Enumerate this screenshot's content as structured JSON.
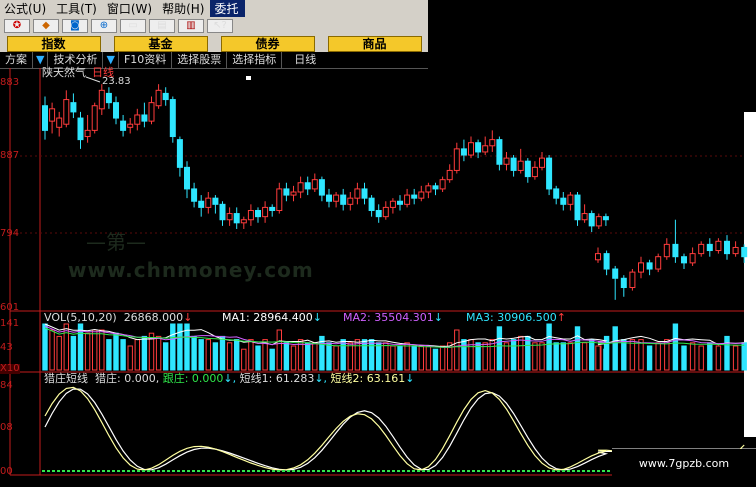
{
  "menu": [
    "公式(U)",
    "工具(T)",
    "窗口(W)",
    "帮助(H)",
    "委托"
  ],
  "categories": [
    "指数",
    "基金",
    "债券",
    "商品"
  ],
  "tabs": [
    "方案",
    "技术分析",
    "F10资料",
    "选择股票",
    "选择指标",
    "日线"
  ],
  "stock": {
    "name": "陕天然气",
    "period": "日线",
    "high_mark": "23.83"
  },
  "price_axis": [
    "883",
    "887",
    "794",
    "601"
  ],
  "vol": {
    "title": "VOL(5,10,20)",
    "value": "26868.000",
    "ma1_label": "MA1:",
    "ma1": "28964.400",
    "ma2_label": "MA2:",
    "ma2": "35504.301",
    "ma3_label": "MA3:",
    "ma3": "30906.500",
    "axis": [
      "141",
      "43",
      "X10"
    ]
  },
  "ind": {
    "title": "猎庄短线",
    "l1": "猎庄: 0.000,",
    "l2": "跟庄: 0.000",
    "l3": "短线1: 61.283",
    "l4": "短线2: 63.161",
    "axis": [
      "84",
      "08",
      "00"
    ]
  },
  "watermark": "www.chnmoney.com",
  "site": "www.7gpzb.com",
  "colors": {
    "up": "#ff3c3c",
    "down": "#2fe6ff",
    "line": "#ffffa0",
    "ma_white": "#ffffff",
    "ma_purple": "#d060ff"
  },
  "chart_data": {
    "type": "candlestick",
    "series": [
      {
        "values": [
          [
            103,
            95,
            92,
            106
          ],
          [
            98,
            102,
            94,
            104
          ],
          [
            96,
            99,
            93,
            101
          ],
          [
            97,
            105,
            96,
            108
          ],
          [
            104,
            101,
            99,
            107
          ],
          [
            99,
            92,
            89,
            101
          ],
          [
            93,
            95,
            91,
            100
          ],
          [
            95,
            103,
            94,
            104
          ],
          [
            102,
            108,
            100,
            110
          ],
          [
            107,
            104,
            102,
            109
          ],
          [
            104,
            99,
            97,
            106
          ],
          [
            98,
            95,
            93,
            100
          ],
          [
            96,
            97,
            94,
            99
          ],
          [
            97,
            100,
            95,
            102
          ],
          [
            100,
            98,
            96,
            104
          ],
          [
            98,
            104,
            97,
            106
          ],
          [
            103,
            108,
            102,
            110
          ],
          [
            107,
            105,
            103,
            109
          ],
          [
            105,
            93,
            91,
            106
          ],
          [
            92,
            83,
            80,
            93
          ],
          [
            83,
            76,
            73,
            85
          ],
          [
            76,
            72,
            70,
            78
          ],
          [
            72,
            70,
            67,
            74
          ],
          [
            70,
            73,
            68,
            75
          ],
          [
            73,
            71,
            68,
            74
          ],
          [
            71,
            66,
            64,
            72
          ],
          [
            66,
            68,
            64,
            70
          ],
          [
            68,
            65,
            63,
            70
          ],
          [
            65,
            66,
            63,
            67
          ],
          [
            66,
            69,
            64,
            71
          ],
          [
            69,
            67,
            65,
            70
          ],
          [
            67,
            70,
            65,
            72
          ],
          [
            70,
            69,
            67,
            71
          ],
          [
            69,
            76,
            68,
            78
          ],
          [
            76,
            74,
            72,
            78
          ],
          [
            74,
            75,
            72,
            77
          ],
          [
            75,
            78,
            73,
            80
          ],
          [
            78,
            76,
            74,
            80
          ],
          [
            76,
            79,
            75,
            81
          ],
          [
            79,
            74,
            72,
            80
          ],
          [
            74,
            72,
            70,
            76
          ],
          [
            72,
            74,
            70,
            75
          ],
          [
            74,
            71,
            69,
            76
          ],
          [
            71,
            73,
            69,
            75
          ],
          [
            73,
            76,
            71,
            78
          ],
          [
            76,
            73,
            71,
            78
          ],
          [
            73,
            69,
            67,
            74
          ],
          [
            69,
            67,
            65,
            71
          ],
          [
            67,
            70,
            66,
            72
          ],
          [
            70,
            72,
            68,
            73
          ],
          [
            72,
            71,
            69,
            74
          ],
          [
            71,
            74,
            70,
            76
          ],
          [
            74,
            73,
            71,
            76
          ],
          [
            73,
            75,
            72,
            77
          ],
          [
            75,
            77,
            73,
            78
          ],
          [
            77,
            76,
            74,
            78
          ],
          [
            76,
            79,
            75,
            80
          ],
          [
            79,
            82,
            78,
            84
          ],
          [
            82,
            89,
            81,
            91
          ],
          [
            89,
            87,
            85,
            92
          ],
          [
            87,
            91,
            86,
            93
          ],
          [
            91,
            88,
            86,
            92
          ],
          [
            88,
            90,
            87,
            93
          ],
          [
            90,
            92,
            88,
            95
          ],
          [
            92,
            84,
            82,
            93
          ],
          [
            84,
            86,
            82,
            88
          ],
          [
            86,
            82,
            80,
            87
          ],
          [
            82,
            85,
            81,
            89
          ],
          [
            85,
            80,
            78,
            86
          ],
          [
            80,
            83,
            79,
            85
          ],
          [
            83,
            86,
            82,
            88
          ],
          [
            86,
            76,
            74,
            87
          ],
          [
            76,
            73,
            71,
            77
          ],
          [
            73,
            71,
            69,
            75
          ],
          [
            71,
            74,
            69,
            75
          ],
          [
            74,
            66,
            64,
            75
          ],
          [
            66,
            68,
            65,
            71
          ],
          [
            68,
            64,
            62,
            69
          ],
          [
            64,
            67,
            63,
            68
          ],
          [
            67,
            66,
            64,
            68
          ],
          [
            53,
            55,
            52,
            57
          ],
          [
            55,
            50,
            48,
            56
          ],
          [
            50,
            47,
            40,
            51
          ],
          [
            47,
            44,
            41,
            48
          ],
          [
            44,
            49,
            43,
            50
          ],
          [
            49,
            52,
            47,
            54
          ],
          [
            52,
            50,
            48,
            53
          ],
          [
            50,
            54,
            49,
            55
          ],
          [
            54,
            58,
            53,
            60
          ],
          [
            58,
            54,
            52,
            66
          ],
          [
            54,
            52,
            50,
            55
          ],
          [
            52,
            55,
            51,
            57
          ],
          [
            55,
            58,
            54,
            59
          ],
          [
            58,
            56,
            54,
            60
          ],
          [
            56,
            59,
            55,
            60
          ],
          [
            59,
            55,
            53,
            61
          ],
          [
            55,
            57,
            54,
            59
          ],
          [
            57,
            54,
            52,
            58
          ]
        ]
      }
    ]
  }
}
